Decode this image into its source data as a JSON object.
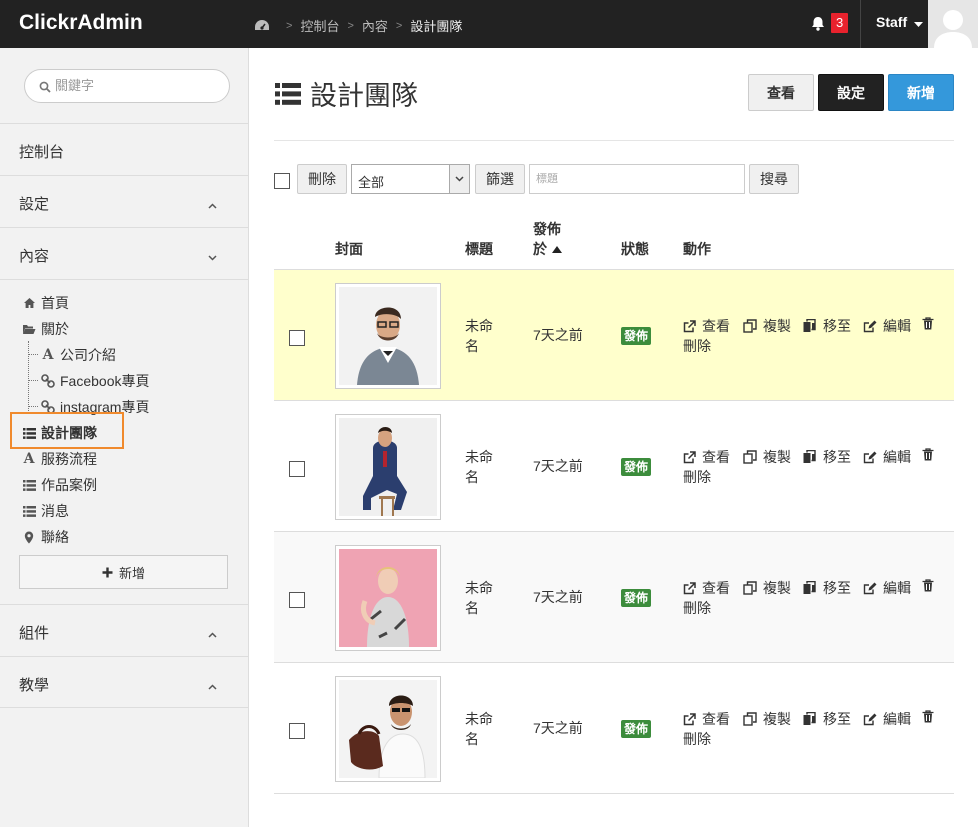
{
  "app": {
    "brand": "ClickrAdmin"
  },
  "breadcrumb": {
    "items": [
      "控制台",
      "內容",
      "設計團隊"
    ]
  },
  "header": {
    "notification_count": "3",
    "user_label": "Staff"
  },
  "sidebar": {
    "search_placeholder": "關鍵字",
    "sections": {
      "dashboard": "控制台",
      "settings": "設定",
      "content": "內容",
      "components": "組件",
      "tutorial": "教學"
    },
    "items": [
      {
        "label": "首頁",
        "icon": "home-icon"
      },
      {
        "label": "關於",
        "icon": "folder-open-icon"
      },
      {
        "label": "公司介紹",
        "icon": "font-icon"
      },
      {
        "label": "Facebook專頁",
        "icon": "link-icon"
      },
      {
        "label": "instagram專頁",
        "icon": "link-icon"
      },
      {
        "label": "設計團隊",
        "icon": "list-icon"
      },
      {
        "label": "服務流程",
        "icon": "font-icon"
      },
      {
        "label": "作品案例",
        "icon": "list-icon"
      },
      {
        "label": "消息",
        "icon": "list-icon"
      },
      {
        "label": "聯絡",
        "icon": "map-marker-icon"
      }
    ],
    "add_label": "新增"
  },
  "page": {
    "title": "設計團隊",
    "buttons": {
      "view": "查看",
      "settings": "設定",
      "add": "新增"
    }
  },
  "filter": {
    "delete_label": "刪除",
    "select_value": "全部",
    "filter_label": "篩選",
    "title_placeholder": "標題",
    "search_label": "搜尋"
  },
  "table": {
    "headers": {
      "cover": "封面",
      "title": "標題",
      "published_line1": "發佈",
      "published_line2": "於",
      "status": "狀態",
      "actions": "動作"
    },
    "actions": {
      "view": "查看",
      "copy": "複製",
      "move": "移至",
      "edit": "編輯",
      "delete": "刪除"
    },
    "rows": [
      {
        "title_line1": "未命",
        "title_line2": "名",
        "published": "7天之前",
        "status": "發佈"
      },
      {
        "title_line1": "未命",
        "title_line2": "名",
        "published": "7天之前",
        "status": "發佈"
      },
      {
        "title_line1": "未命",
        "title_line2": "名",
        "published": "7天之前",
        "status": "發佈"
      },
      {
        "title_line1": "未命",
        "title_line2": "名",
        "published": "7天之前",
        "status": "發佈"
      }
    ]
  },
  "colors": {
    "topbar": "#222222",
    "accent_blue": "#3498db",
    "status_green": "#3c8c3c",
    "highlight_row": "#ffffcc",
    "badge_red": "#e8222d",
    "selection_outline": "#f08a2d"
  }
}
